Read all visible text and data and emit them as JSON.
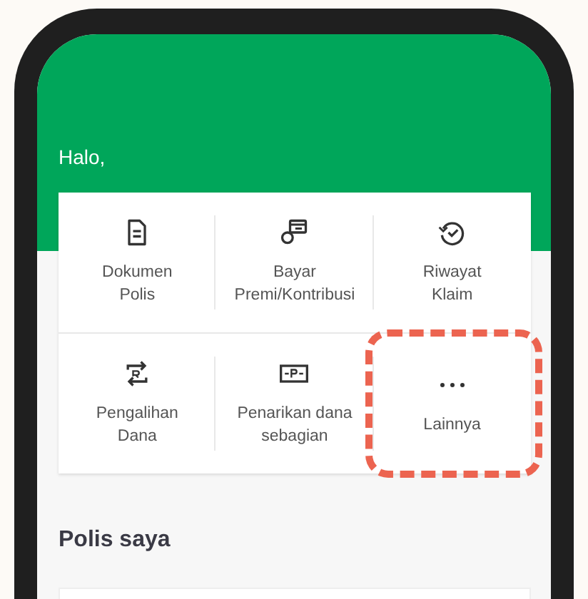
{
  "greeting": "Halo,",
  "menu": [
    {
      "label": "Dokumen\nPolis",
      "kind": "document",
      "highlighted": false
    },
    {
      "label": "Bayar\nPremi/Kontribusi",
      "kind": "card",
      "highlighted": false
    },
    {
      "label": "Riwayat\nKlaim",
      "kind": "history",
      "highlighted": false
    },
    {
      "label": "Pengalihan\nDana",
      "kind": "transfer",
      "highlighted": false
    },
    {
      "label": "Penarikan dana\nsebagian",
      "kind": "cash",
      "highlighted": false
    },
    {
      "label": "Lainnya",
      "kind": "more",
      "highlighted": true
    }
  ],
  "section_title": "Polis saya"
}
